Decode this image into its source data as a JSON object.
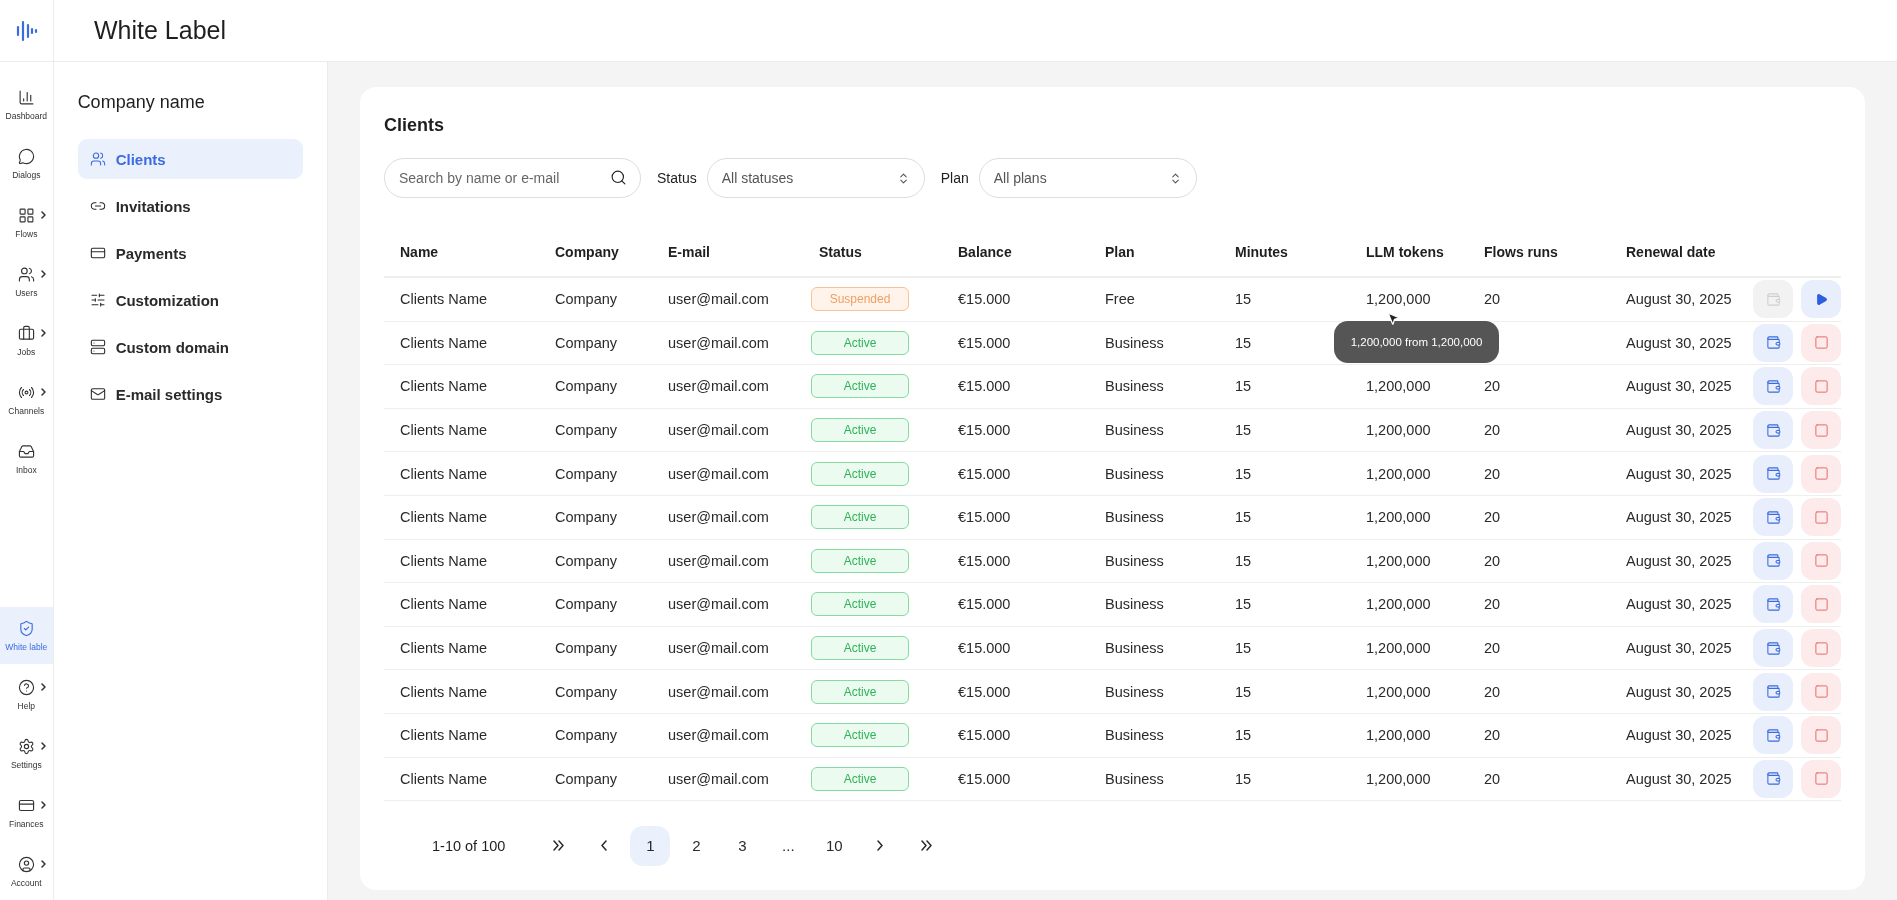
{
  "header": {
    "title": "White Label"
  },
  "rail": [
    {
      "label": "Dashboard",
      "has_submenu": false,
      "selected": false
    },
    {
      "label": "Dialogs",
      "has_submenu": false,
      "selected": false
    },
    {
      "label": "Flows",
      "has_submenu": true,
      "selected": false
    },
    {
      "label": "Users",
      "has_submenu": true,
      "selected": false
    },
    {
      "label": "Jobs",
      "has_submenu": true,
      "selected": false
    },
    {
      "label": "Channels",
      "has_submenu": true,
      "selected": false
    },
    {
      "label": "Inbox",
      "has_submenu": false,
      "selected": false
    }
  ],
  "rail_bottom": [
    {
      "label": "White lable",
      "has_submenu": false,
      "selected": true
    },
    {
      "label": "Help",
      "has_submenu": true,
      "selected": false
    },
    {
      "label": "Settings",
      "has_submenu": true,
      "selected": false
    },
    {
      "label": "Finances",
      "has_submenu": true,
      "selected": false
    },
    {
      "label": "Account",
      "has_submenu": true,
      "selected": false
    }
  ],
  "sidebar": {
    "title": "Company name",
    "items": [
      {
        "label": "Clients",
        "selected": true
      },
      {
        "label": "Invitations",
        "selected": false
      },
      {
        "label": "Payments",
        "selected": false
      },
      {
        "label": "Customization",
        "selected": false
      },
      {
        "label": "Custom domain",
        "selected": false
      },
      {
        "label": "E-mail settings",
        "selected": false
      }
    ]
  },
  "card": {
    "title": "Clients",
    "search": {
      "placeholder": "Search by name or e-mail"
    },
    "filters": [
      {
        "label": "Status",
        "value": "All statuses"
      },
      {
        "label": "Plan",
        "value": "All plans"
      }
    ],
    "columns": [
      "Name",
      "Company",
      "E-mail",
      "Status",
      "Balance",
      "Plan",
      "Minutes",
      "LLM tokens",
      "Flows runs",
      "Renewal date"
    ],
    "rows": [
      {
        "name": "Clients Name",
        "company": "Company",
        "email": "user@mail.com",
        "status": {
          "label": "Suspended",
          "kind": "suspended"
        },
        "balance": "€15.000",
        "plan": "Free",
        "minutes": "15",
        "llm_tokens": "1,200,000",
        "llm_tooltip": "1,200,000 from 1,200,000",
        "flows_runs": "20",
        "renewal": "August 30, 2025",
        "wallet_disabled": true,
        "action": {
          "kind": "play"
        }
      },
      {
        "name": "Clients Name",
        "company": "Company",
        "email": "user@mail.com",
        "status": {
          "label": "Active",
          "kind": "active"
        },
        "balance": "€15.000",
        "plan": "Business",
        "minutes": "15",
        "renewal": "August 30, 2025",
        "wallet_disabled": false,
        "action": {
          "kind": "stop"
        }
      },
      {
        "name": "Clients Name",
        "company": "Company",
        "email": "user@mail.com",
        "status": {
          "label": "Active",
          "kind": "active"
        },
        "balance": "€15.000",
        "plan": "Business",
        "minutes": "15",
        "llm_tokens": "1,200,000",
        "flows_runs": "20",
        "renewal": "August 30, 2025",
        "wallet_disabled": false,
        "action": {
          "kind": "stop"
        }
      },
      {
        "name": "Clients Name",
        "company": "Company",
        "email": "user@mail.com",
        "status": {
          "label": "Active",
          "kind": "active"
        },
        "balance": "€15.000",
        "plan": "Business",
        "minutes": "15",
        "llm_tokens": "1,200,000",
        "flows_runs": "20",
        "renewal": "August 30, 2025",
        "wallet_disabled": false,
        "action": {
          "kind": "stop"
        }
      },
      {
        "name": "Clients Name",
        "company": "Company",
        "email": "user@mail.com",
        "status": {
          "label": "Active",
          "kind": "active"
        },
        "balance": "€15.000",
        "plan": "Business",
        "minutes": "15",
        "llm_tokens": "1,200,000",
        "flows_runs": "20",
        "renewal": "August 30, 2025",
        "wallet_disabled": false,
        "action": {
          "kind": "stop"
        }
      },
      {
        "name": "Clients Name",
        "company": "Company",
        "email": "user@mail.com",
        "status": {
          "label": "Active",
          "kind": "active"
        },
        "balance": "€15.000",
        "plan": "Business",
        "minutes": "15",
        "llm_tokens": "1,200,000",
        "flows_runs": "20",
        "renewal": "August 30, 2025",
        "wallet_disabled": false,
        "action": {
          "kind": "stop"
        }
      },
      {
        "name": "Clients Name",
        "company": "Company",
        "email": "user@mail.com",
        "status": {
          "label": "Active",
          "kind": "active"
        },
        "balance": "€15.000",
        "plan": "Business",
        "minutes": "15",
        "llm_tokens": "1,200,000",
        "flows_runs": "20",
        "renewal": "August 30, 2025",
        "wallet_disabled": false,
        "action": {
          "kind": "stop"
        }
      },
      {
        "name": "Clients Name",
        "company": "Company",
        "email": "user@mail.com",
        "status": {
          "label": "Active",
          "kind": "active"
        },
        "balance": "€15.000",
        "plan": "Business",
        "minutes": "15",
        "llm_tokens": "1,200,000",
        "flows_runs": "20",
        "renewal": "August 30, 2025",
        "wallet_disabled": false,
        "action": {
          "kind": "stop"
        }
      },
      {
        "name": "Clients Name",
        "company": "Company",
        "email": "user@mail.com",
        "status": {
          "label": "Active",
          "kind": "active"
        },
        "balance": "€15.000",
        "plan": "Business",
        "minutes": "15",
        "llm_tokens": "1,200,000",
        "flows_runs": "20",
        "renewal": "August 30, 2025",
        "wallet_disabled": false,
        "action": {
          "kind": "stop"
        }
      },
      {
        "name": "Clients Name",
        "company": "Company",
        "email": "user@mail.com",
        "status": {
          "label": "Active",
          "kind": "active"
        },
        "balance": "€15.000",
        "plan": "Business",
        "minutes": "15",
        "llm_tokens": "1,200,000",
        "flows_runs": "20",
        "renewal": "August 30, 2025",
        "wallet_disabled": false,
        "action": {
          "kind": "stop"
        }
      },
      {
        "name": "Clients Name",
        "company": "Company",
        "email": "user@mail.com",
        "status": {
          "label": "Active",
          "kind": "active"
        },
        "balance": "€15.000",
        "plan": "Business",
        "minutes": "15",
        "llm_tokens": "1,200,000",
        "flows_runs": "20",
        "renewal": "August 30, 2025",
        "wallet_disabled": false,
        "action": {
          "kind": "stop"
        }
      },
      {
        "name": "Clients Name",
        "company": "Company",
        "email": "user@mail.com",
        "status": {
          "label": "Active",
          "kind": "active"
        },
        "balance": "€15.000",
        "plan": "Business",
        "minutes": "15",
        "llm_tokens": "1,200,000",
        "flows_runs": "20",
        "renewal": "August 30, 2025",
        "wallet_disabled": false,
        "action": {
          "kind": "stop"
        }
      }
    ],
    "pagination": {
      "summary": "1-10 of 100",
      "pages": [
        {
          "label": "1",
          "selected": true
        },
        {
          "label": "2",
          "selected": false
        },
        {
          "label": "3",
          "selected": false
        },
        {
          "label": "...",
          "selected": false
        },
        {
          "label": "10",
          "selected": false
        }
      ]
    }
  }
}
